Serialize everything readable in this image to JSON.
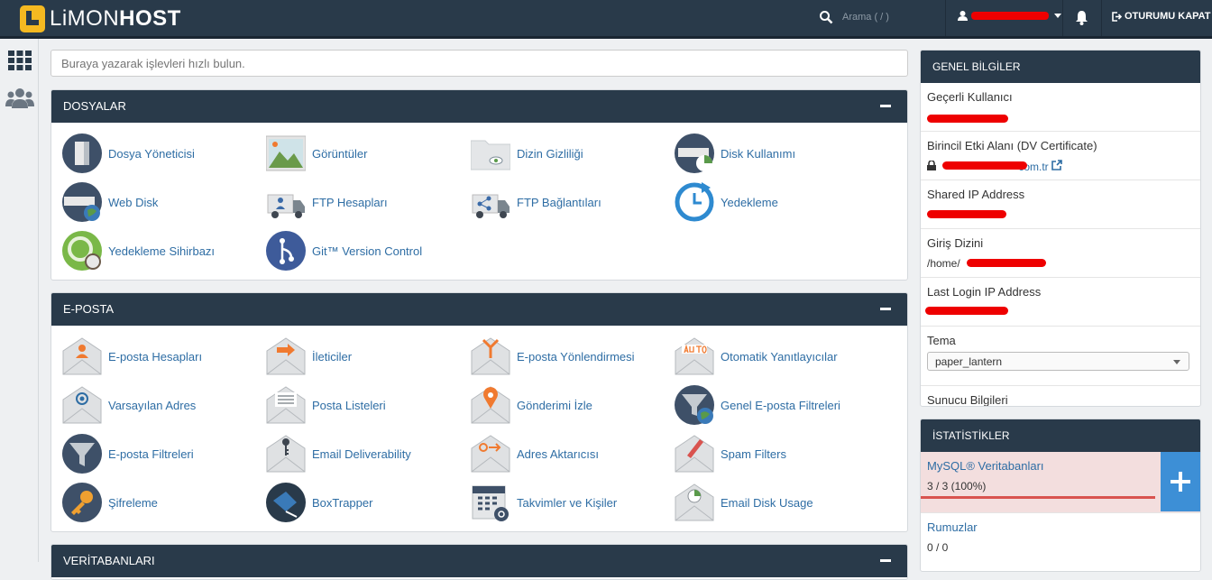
{
  "brand": {
    "name_light": "LiMON",
    "name_bold": "HOST"
  },
  "topbar": {
    "search_placeholder": "Arama ( / )",
    "logout_label": "OTURUMU KAPAT"
  },
  "quick_search": {
    "placeholder": "Buraya yazarak işlevleri hızlı bulun."
  },
  "sections": {
    "files": {
      "title": "DOSYALAR",
      "items": [
        {
          "label": "Dosya Yöneticisi"
        },
        {
          "label": "Görüntüler"
        },
        {
          "label": "Dizin Gizliliği"
        },
        {
          "label": "Disk Kullanımı"
        },
        {
          "label": "Web Disk"
        },
        {
          "label": "FTP Hesapları"
        },
        {
          "label": "FTP Bağlantıları"
        },
        {
          "label": "Yedekleme"
        },
        {
          "label": "Yedekleme Sihirbazı"
        },
        {
          "label": "Git™ Version Control"
        }
      ]
    },
    "email": {
      "title": "E-POSTA",
      "items": [
        {
          "label": "E-posta Hesapları"
        },
        {
          "label": "İleticiler"
        },
        {
          "label": "E-posta Yönlendirmesi"
        },
        {
          "label": "Otomatik Yanıtlayıcılar"
        },
        {
          "label": "Varsayılan Adres"
        },
        {
          "label": "Posta Listeleri"
        },
        {
          "label": "Gönderimi İzle"
        },
        {
          "label": "Genel E-posta Filtreleri"
        },
        {
          "label": "E-posta Filtreleri"
        },
        {
          "label": "Email Deliverability"
        },
        {
          "label": "Adres Aktarıcısı"
        },
        {
          "label": "Spam Filters"
        },
        {
          "label": "Şifreleme"
        },
        {
          "label": "BoxTrapper"
        },
        {
          "label": "Takvimler ve Kişiler"
        },
        {
          "label": "Email Disk Usage"
        }
      ]
    },
    "databases": {
      "title": "VERİTABANLARI"
    }
  },
  "general_info": {
    "title": "GENEL BİLGİLER",
    "current_user_label": "Geçerli Kullanıcı",
    "primary_domain_label": "Birincil Etki Alanı (DV Certificate)",
    "primary_domain_suffix": "com.tr",
    "shared_ip_label": "Shared IP Address",
    "home_dir_label": "Giriş Dizini",
    "home_dir_prefix": "/home/",
    "last_login_label": "Last Login IP Address",
    "theme_label": "Tema",
    "theme_value": "paper_lantern",
    "server_info_link": "Sunucu Bilgileri"
  },
  "stats": {
    "title": "İSTATİSTİKLER",
    "mysql": {
      "label": "MySQL® Veritabanları",
      "value": "3 / 3   (100%)",
      "usage_fraction": 1.0
    },
    "aliases": {
      "label": "Rumuzlar",
      "value": "0 / 0"
    }
  }
}
